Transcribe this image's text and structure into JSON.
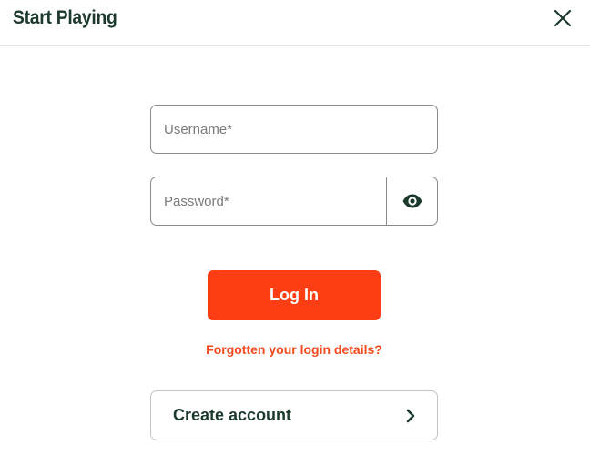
{
  "header": {
    "title": "Start Playing"
  },
  "form": {
    "username_placeholder": "Username*",
    "password_placeholder": "Password*",
    "login_label": "Log In",
    "forgot_label": "Forgotten your login details?",
    "create_account_label": "Create account"
  },
  "icons": {
    "close": "close-icon",
    "password_toggle": "eye-icon",
    "create_arrow": "chevron-right-icon"
  },
  "colors": {
    "brand_dark_green": "#1c3a2b",
    "accent_orange": "#fd3d14",
    "link_orange": "#f24a1c"
  }
}
